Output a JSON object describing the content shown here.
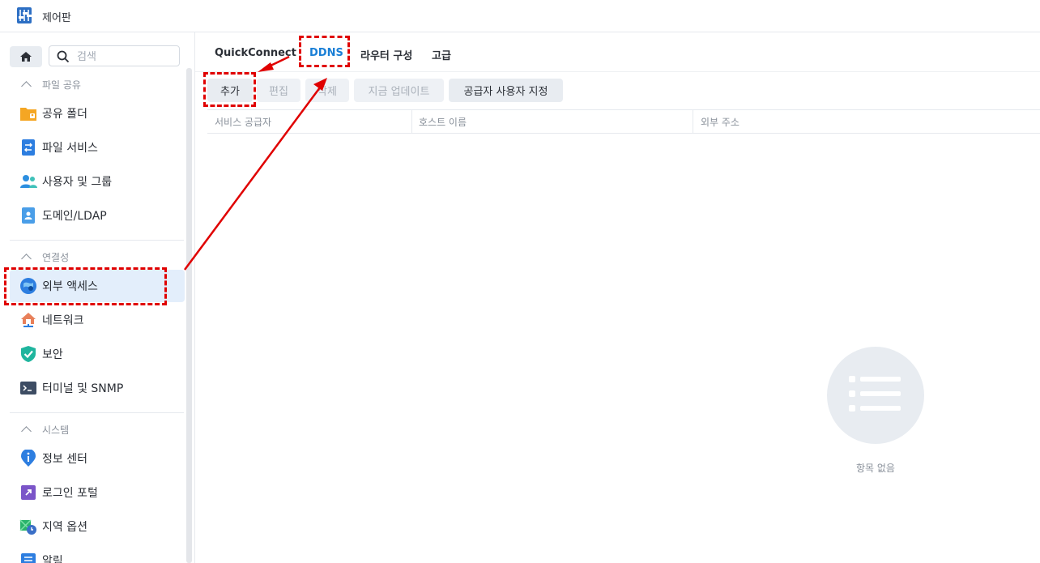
{
  "window": {
    "title": "제어판"
  },
  "sidebar": {
    "search_placeholder": "검색",
    "groups": [
      {
        "label": "파일 공유",
        "items": [
          "공유 폴더",
          "파일 서비스",
          "사용자 및 그룹",
          "도메인/LDAP"
        ]
      },
      {
        "label": "연결성",
        "items": [
          "외부 액세스",
          "네트워크",
          "보안",
          "터미널 및 SNMP"
        ]
      },
      {
        "label": "시스템",
        "items": [
          "정보 센터",
          "로그인 포털",
          "지역 옵션",
          "알림"
        ]
      }
    ],
    "active_item": "외부 액세스"
  },
  "tabs": [
    "QuickConnect",
    "DDNS",
    "라우터 구성",
    "고급"
  ],
  "active_tab": "DDNS",
  "toolbar": {
    "add": "추가",
    "edit": "편집",
    "delete": "삭제",
    "update_now": "지금 업데이트",
    "custom_provider": "공급자 사용자 지정"
  },
  "table": {
    "columns": [
      "서비스 공급자",
      "호스트 이름",
      "외부 주소"
    ],
    "rows": []
  },
  "empty_state": {
    "text": "항목 없음"
  },
  "colors": {
    "accent": "#1a7fd6",
    "annotation": "#e00000",
    "active_bg": "#e3eefb"
  }
}
